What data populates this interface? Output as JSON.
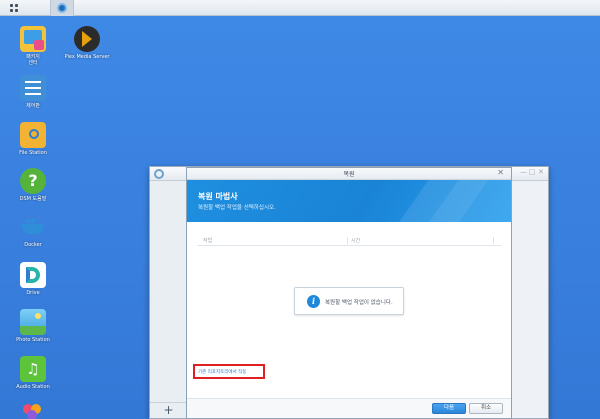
{
  "taskbar": {
    "main_menu_icon": "grid-icon",
    "open_app_icon": "hyper-backup-icon"
  },
  "desktop": {
    "icons": [
      {
        "label": "패키지\n센터",
        "icon": "package-center-icon",
        "color": "#f2c23a"
      },
      {
        "label": "Plex Media Server",
        "icon": "plex-icon",
        "color": "#2b2b2b"
      },
      {
        "label": "제어판",
        "icon": "control-panel-icon",
        "color": "#3f8fd8"
      },
      {
        "label": "File Station",
        "icon": "file-station-icon",
        "color": "#f2b233"
      },
      {
        "label": "DSM 도움말",
        "icon": "help-icon",
        "color": "#55b33b"
      },
      {
        "label": "Docker",
        "icon": "docker-icon",
        "color": "#2f8ed8"
      },
      {
        "label": "Drive",
        "icon": "drive-icon",
        "color": "#26b5a8"
      },
      {
        "label": "Photo Station",
        "icon": "photo-station-icon",
        "color": "#3aa0e0"
      },
      {
        "label": "Audio Station",
        "icon": "audio-station-icon",
        "color": "#5cc33a"
      }
    ]
  },
  "window": {
    "add_label": "+",
    "controls": [
      "—",
      "□",
      "✕"
    ]
  },
  "dialog": {
    "title": "복원",
    "close": "✕",
    "banner_title": "복원 마법사",
    "banner_subtitle": "복원할 백업 작업을 선택하십시오.",
    "columns": [
      "작업",
      "시간"
    ],
    "empty_message": "복원할 백업 작업이 없습니다.",
    "link": "기존 리포지토리에서 작동",
    "next_button": "다음",
    "cancel_button": "취소"
  }
}
